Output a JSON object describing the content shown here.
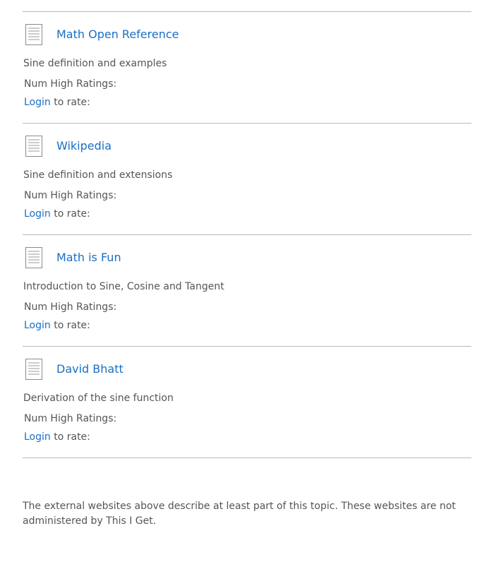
{
  "resources": [
    {
      "icon": "document-icon",
      "title": "Math Open Reference",
      "description": "Sine definition and examples",
      "ratings_label": "Num High Ratings:",
      "login_label": "Login",
      "rate_suffix": " to rate:"
    },
    {
      "icon": "document-icon",
      "title": "Wikipedia",
      "description": "Sine definition and extensions",
      "ratings_label": "Num High Ratings:",
      "login_label": "Login",
      "rate_suffix": " to rate:"
    },
    {
      "icon": "document-icon",
      "title": "Math is Fun",
      "description": "Introduction to Sine, Cosine and Tangent",
      "ratings_label": "Num High Ratings:",
      "login_label": "Login",
      "rate_suffix": " to rate:"
    },
    {
      "icon": "document-icon",
      "title": "David Bhatt",
      "description": "Derivation of the sine function",
      "ratings_label": "Num High Ratings:",
      "login_label": "Login",
      "rate_suffix": " to rate:"
    }
  ],
  "footer": {
    "note": "The external websites above describe at least part of this topic. These websites are not administered by This I Get."
  },
  "colors": {
    "link": "#1a6fc4",
    "text": "#555555",
    "divider": "#b9b9b9"
  }
}
